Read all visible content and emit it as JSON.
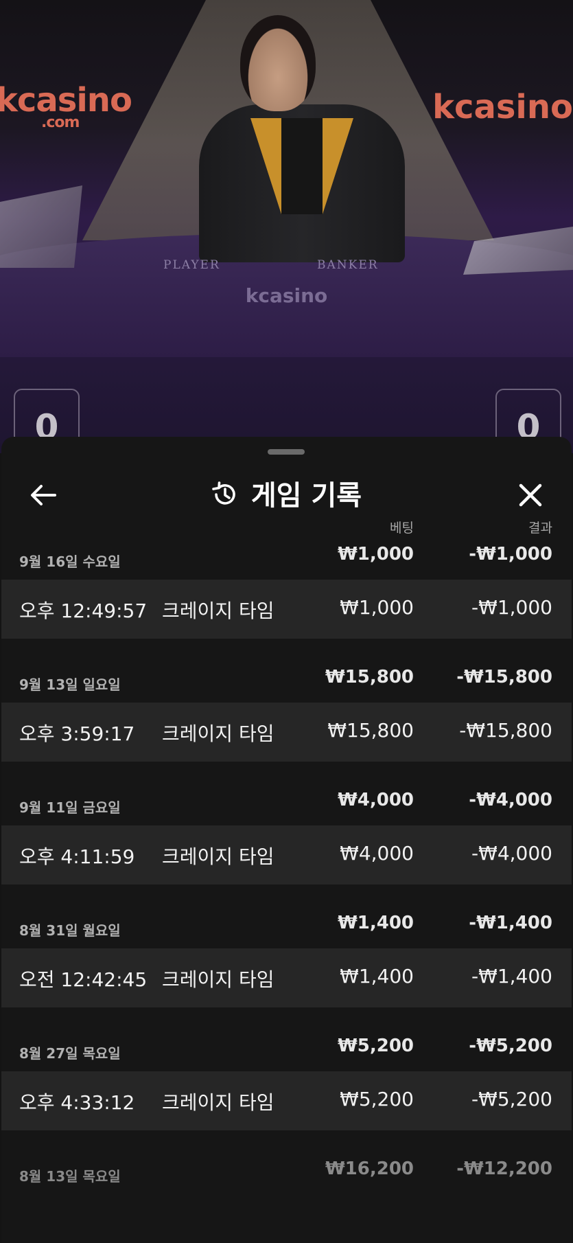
{
  "video": {
    "logo_left": "kcasino",
    "logo_left_sub": ".com",
    "logo_right": "kcasino",
    "player_label": "PLAYER",
    "banker_label": "BANKER",
    "table_logo": "kcasino",
    "player_score": "0",
    "banker_score": "0"
  },
  "sheet": {
    "title": "게임 기록",
    "back_icon": "arrow-left-icon",
    "history_icon": "history-icon",
    "close_icon": "close-icon",
    "col_bet": "베팅",
    "col_result": "결과"
  },
  "history": [
    {
      "date": "9월 16일 수요일",
      "total_bet": "₩1,000",
      "total_result": "-₩1,000",
      "games": [
        {
          "time": "오후 12:49:57",
          "game": "크레이지 타임",
          "bet": "₩1,000",
          "result": "-₩1,000"
        }
      ]
    },
    {
      "date": "9월 13일 일요일",
      "total_bet": "₩15,800",
      "total_result": "-₩15,800",
      "games": [
        {
          "time": "오후 3:59:17",
          "game": "크레이지 타임",
          "bet": "₩15,800",
          "result": "-₩15,800"
        }
      ]
    },
    {
      "date": "9월 11일 금요일",
      "total_bet": "₩4,000",
      "total_result": "-₩4,000",
      "games": [
        {
          "time": "오후 4:11:59",
          "game": "크레이지 타임",
          "bet": "₩4,000",
          "result": "-₩4,000"
        }
      ]
    },
    {
      "date": "8월 31일 월요일",
      "total_bet": "₩1,400",
      "total_result": "-₩1,400",
      "games": [
        {
          "time": "오전 12:42:45",
          "game": "크레이지 타임",
          "bet": "₩1,400",
          "result": "-₩1,400"
        }
      ]
    },
    {
      "date": "8월 27일 목요일",
      "total_bet": "₩5,200",
      "total_result": "-₩5,200",
      "games": [
        {
          "time": "오후 4:33:12",
          "game": "크레이지 타임",
          "bet": "₩5,200",
          "result": "-₩5,200"
        }
      ]
    },
    {
      "date": "8월 13일 목요일",
      "total_bet": "₩16,200",
      "total_result": "-₩12,200",
      "games": []
    }
  ],
  "colors": {
    "sheet_bg": "#161616",
    "row_bg": "#262626",
    "table_purple": "#2e1b47",
    "logo_orange": "#d96a55"
  }
}
